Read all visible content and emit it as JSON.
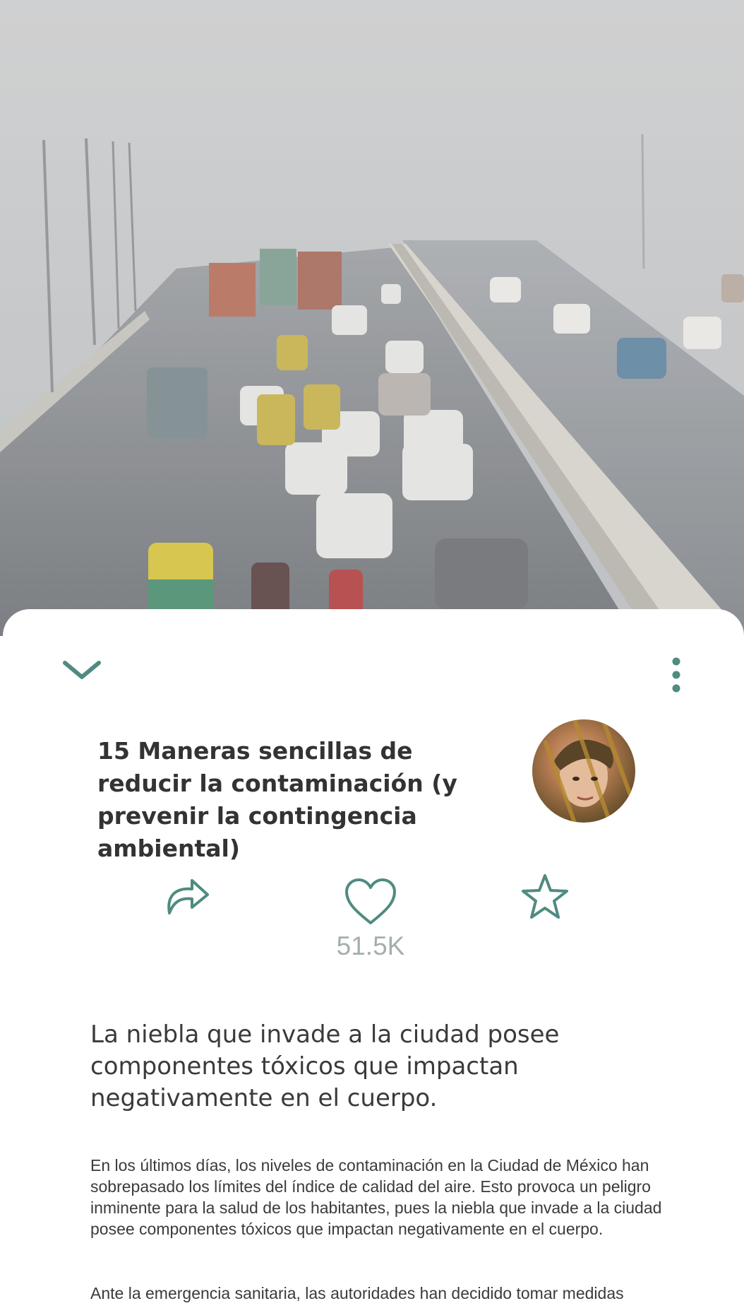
{
  "hero": {
    "icon": "hero-photo"
  },
  "colors": {
    "accent": "#4f8b80",
    "count": "#a3afad",
    "title": "#333333"
  },
  "article": {
    "title": "15 Maneras sencillas de reducir la contaminación (y prevenir la contingencia ambiental)",
    "subtitle": "La niebla que invade a la ciudad posee componentes tóxicos que impactan negativamente en el cuerpo.",
    "paragraphs": [
      "En los últimos días, los niveles de contaminación en la Ciudad de México han sobrepasado los límites del índice de calidad del aire. Esto provoca un peligro inminente para la salud de los habitantes, pues la niebla que invade a la ciudad posee componentes tóxicos que impactan negativamente en el cuerpo.",
      "Ante la emergencia sanitaria, las autoridades han decidido tomar medidas"
    ]
  },
  "actions": {
    "like_count": "51.5K",
    "share_icon": "share-icon",
    "like_icon": "heart-icon",
    "favorite_icon": "star-icon",
    "collapse_icon": "chevron-down-icon",
    "menu_icon": "more-vertical-icon"
  }
}
